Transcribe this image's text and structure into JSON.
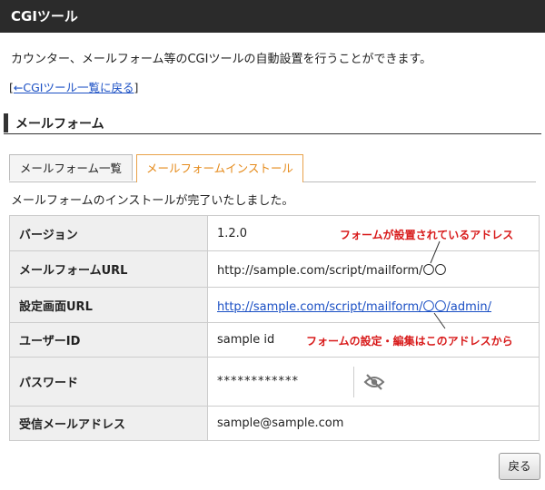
{
  "header": {
    "title": "CGIツール"
  },
  "intro": "カウンター、メールフォーム等のCGIツールの自動設置を行うことができます。",
  "back_link": {
    "open": "[",
    "label": "←CGIツール一覧に戻る",
    "close": "]"
  },
  "section_title": "メールフォーム",
  "tabs": [
    {
      "label": "メールフォーム一覧"
    },
    {
      "label": "メールフォームインストール"
    }
  ],
  "complete_message": "メールフォームのインストールが完了いたしました。",
  "rows": {
    "version": {
      "label": "バージョン",
      "value": "1.2.0"
    },
    "form_url": {
      "label": "メールフォームURL",
      "value": "http://sample.com/script/mailform/〇〇"
    },
    "admin_url": {
      "label": "設定画面URL",
      "value": "http://sample.com/script/mailform/〇〇/admin/"
    },
    "user_id": {
      "label": "ユーザーID",
      "value": "sample id"
    },
    "password": {
      "label": "パスワード",
      "value": "************"
    },
    "email": {
      "label": "受信メールアドレス",
      "value": "sample@sample.com"
    }
  },
  "annotations": {
    "form_location": "フォームが設置されているアドレス",
    "settings_location": "フォームの設定・編集はこのアドレスから"
  },
  "colors": {
    "annotation": "#d81b1b",
    "active_tab": "#e58a1a",
    "link": "#1a4fc4"
  },
  "icons": {
    "toggle_password": "eye-slash-icon"
  },
  "buttons": {
    "back": "戻る"
  }
}
